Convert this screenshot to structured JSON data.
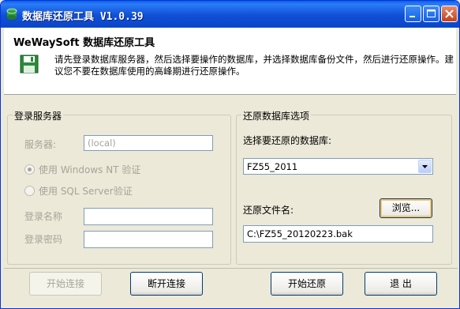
{
  "window": {
    "title": "数据库还原工具 V1.0.39"
  },
  "header": {
    "title": "WeWaySoft 数据库还原工具",
    "description": "请先登录数据库服务器，然后选择要操作的数据库，并选择数据库备份文件，然后进行还原操作。建议您不要在数据库使用的高峰期进行还原操作。"
  },
  "login_group": {
    "legend": "登录服务器",
    "server_label": "服务器:",
    "server_value": "(local)",
    "radio_windows": "使用 Windows NT 验证",
    "radio_sql": "使用 SQL Server验证",
    "username_label": "登录名称",
    "username_value": "",
    "password_label": "登录密码",
    "password_value": ""
  },
  "restore_group": {
    "legend": "还原数据库选项",
    "select_db_label": "选择要还原的数据库:",
    "selected_db": "FZ55_2011",
    "filename_label": "还原文件名:",
    "browse_label": "浏览...",
    "filename_value": "C:\\FZ55_20120223.bak"
  },
  "buttons": {
    "connect": "开始连接",
    "disconnect": "断开连接",
    "start_restore": "开始还原",
    "exit": "退 出"
  },
  "icons": [
    "app-icon",
    "minimize-icon",
    "maximize-icon",
    "close-icon",
    "floppy-disk-icon",
    "dropdown-arrow-icon"
  ]
}
